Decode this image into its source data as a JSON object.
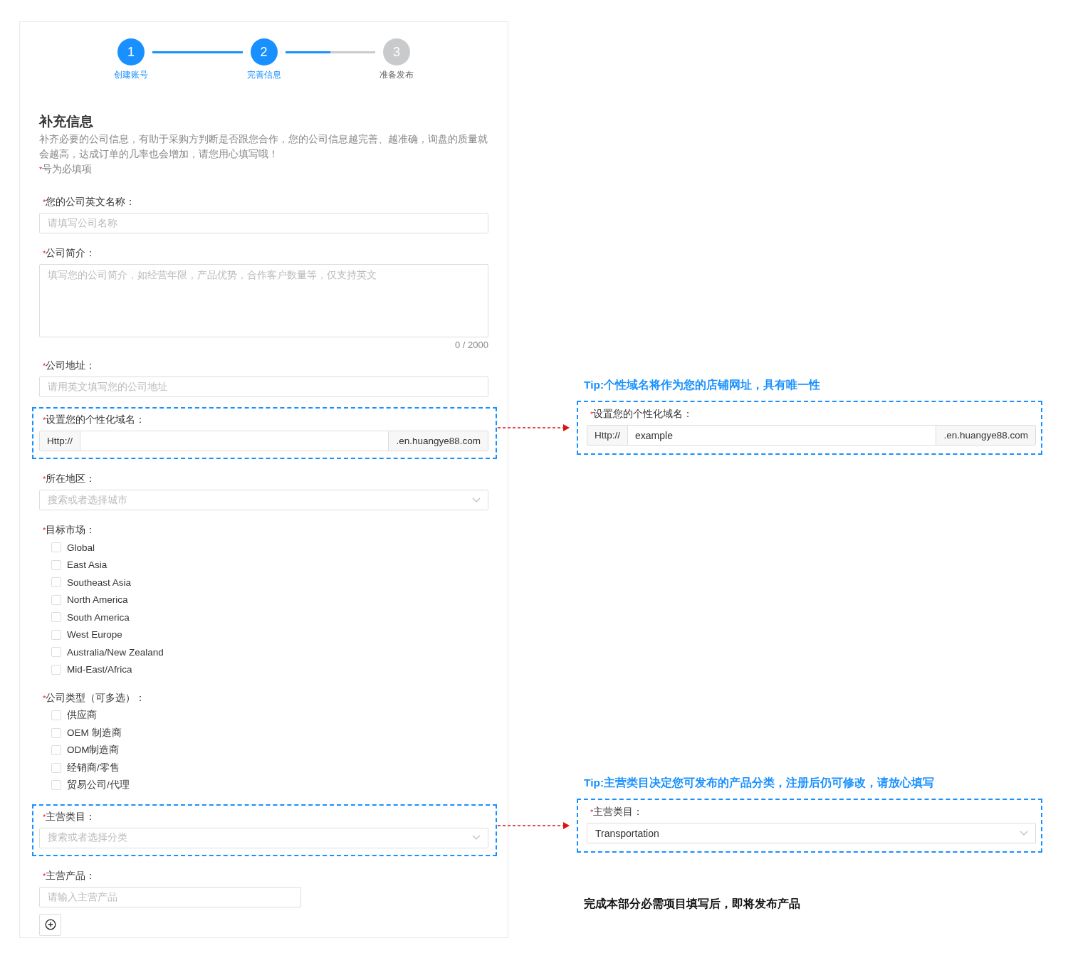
{
  "steps": [
    {
      "number": "1",
      "label": "创建账号",
      "done": true,
      "active": false
    },
    {
      "number": "2",
      "label": "完善信息",
      "done": false,
      "active": true
    },
    {
      "number": "3",
      "label": "准备发布",
      "done": false,
      "active": false
    }
  ],
  "step_connectors": [
    {
      "level": 1
    },
    {
      "level": 0.5
    }
  ],
  "section": {
    "title": "补充信息",
    "description": "补齐必要的公司信息，有助于采购方判断是否跟您合作，您的公司信息越完善、越准确，询盘的质量就会越高，达成订单的几率也会增加，请您用心填写哦！",
    "required_note": {
      "mark": "*",
      "text": "号为必填项"
    }
  },
  "fields": [
    {
      "kind": "text",
      "mark": "*",
      "label": "您的公司英文名称：",
      "placeholder": "请填写公司名称",
      "highlighted": false
    },
    {
      "kind": "textarea",
      "mark": "*",
      "label": "公司简介：",
      "placeholder": "填写您的公司简介，如经营年限，产品优势，合作客户数量等，仅支持英文",
      "counter": "0 / 2000",
      "highlighted": false
    },
    {
      "kind": "text",
      "mark": "*",
      "label": "公司地址：",
      "placeholder": "请用英文填写您的公司地址",
      "highlighted": false
    },
    {
      "kind": "domain",
      "mark": "*",
      "label": "设置您的个性化域名：",
      "prefix": "Http://",
      "suffix": ".en.huangye88.com",
      "highlighted": true
    },
    {
      "kind": "select",
      "mark": "*",
      "label": "所在地区：",
      "placeholder": "搜索或者选择城市",
      "highlighted": false
    },
    {
      "kind": "checkboxes",
      "mark": "*",
      "label": "目标市场：",
      "highlighted": false,
      "options": [
        {
          "label": "Global",
          "checked": false
        },
        {
          "label": "East Asia",
          "checked": false
        },
        {
          "label": "Southeast Asia",
          "checked": false
        },
        {
          "label": "North America",
          "checked": false
        },
        {
          "label": "South America",
          "checked": false
        },
        {
          "label": "West Europe",
          "checked": false
        },
        {
          "label": "Australia/New Zealand",
          "checked": false
        },
        {
          "label": "Mid-East/Africa",
          "checked": false
        }
      ]
    },
    {
      "kind": "checkboxes",
      "mark": "*",
      "label": "公司类型（可多选）：",
      "highlighted": false,
      "options": [
        {
          "label": "供应商",
          "checked": false
        },
        {
          "label": "OEM 制造商",
          "checked": false
        },
        {
          "label": "ODM制造商",
          "checked": false
        },
        {
          "label": "经销商/零售",
          "checked": false
        },
        {
          "label": "贸易公司/代理",
          "checked": false
        }
      ]
    },
    {
      "kind": "select",
      "mark": "*",
      "label": "主营类目：",
      "placeholder": "搜索或者选择分类",
      "highlighted": true
    },
    {
      "kind": "product",
      "mark": "*",
      "label": "主营产品：",
      "placeholder": "请输入主营产品",
      "highlighted": false
    }
  ],
  "annotations": [
    {
      "tip": "Tip:个性域名将作为您的店铺网址，具有唯一性",
      "field": {
        "kind": "domain",
        "mark": "*",
        "label": "设置您的个性化域名：",
        "prefix": "Http://",
        "value": "example",
        "suffix": ".en.huangye88.com"
      }
    },
    {
      "tip": "Tip:主营类目决定您可发布的产品分类，注册后仍可修改，请放心填写",
      "field": {
        "kind": "select",
        "mark": "*",
        "label": "主营类目：",
        "value": "Transportation"
      }
    }
  ],
  "final_note": "完成本部分必需项目填写后，即将发布产品"
}
